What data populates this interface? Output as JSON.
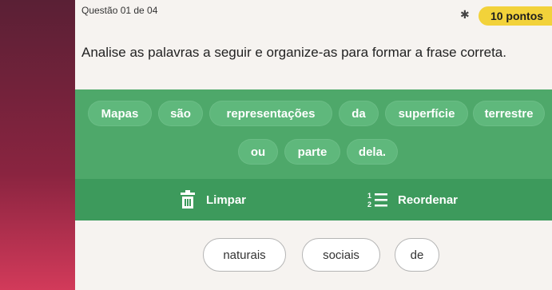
{
  "header": {
    "question_counter": "Questão 01 de 04",
    "points": "10 pontos",
    "star_icon": "asterisk-icon"
  },
  "question": {
    "prompt": "Analise as palavras a seguir e organize-as para formar a frase correta."
  },
  "answer_words": [
    "Mapas",
    "são",
    "representações",
    "da",
    "superfície",
    "terrestre",
    "ou",
    "parte",
    "dela."
  ],
  "actions": {
    "clear_label": "Limpar",
    "reorder_label": "Reordenar"
  },
  "word_bank": [
    "naturais",
    "sociais",
    "de"
  ],
  "colors": {
    "answer_area": "#4ea86a",
    "chip": "#5fb87c",
    "action_bar": "#3d9a5c",
    "badge": "#f2d23a"
  }
}
